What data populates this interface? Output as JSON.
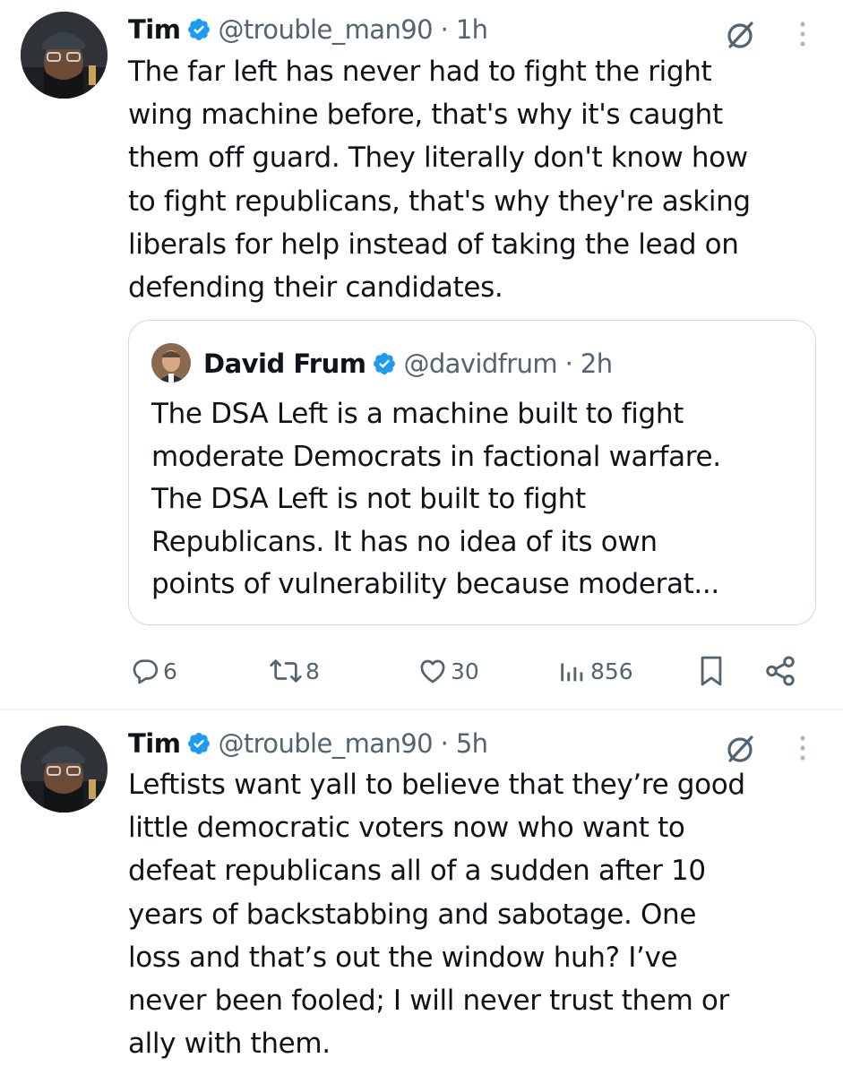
{
  "tweets": [
    {
      "author": {
        "name": "Tim",
        "handle": "@trouble_man90",
        "time": "1h"
      },
      "text": "The far left has never had to fight the right\nwing machine before, that's why it's caught\nthem off guard. They literally don't know how\nto fight republicans, that's why they're asking\nliberals for help instead of taking the lead on\ndefending their candidates.",
      "quoted": {
        "author": {
          "name": "David Frum",
          "handle": "@davidfrum",
          "time": "2h"
        },
        "text": "The DSA Left is a machine built to fight\nmoderate Democrats in factional warfare.\nThe DSA Left is not built to fight\nRepublicans. It has no idea of its own\npoints of vulnerability because moderat..."
      },
      "actions": {
        "replies": "6",
        "reposts": "8",
        "likes": "30",
        "views": "856"
      }
    },
    {
      "author": {
        "name": "Tim",
        "handle": "@trouble_man90",
        "time": "5h"
      },
      "text": "Leftists want yall to believe that they’re good\nlittle democratic voters now who want to\ndefeat republicans all of a sudden after 10\nyears of backstabbing and sabotage. One\nloss and that’s out the window huh? I’ve\nnever been fooled; I will never trust them or\nally with them."
    }
  ],
  "separator": " · ",
  "colors": {
    "text": "#0f1419",
    "secondary": "#536471",
    "verified": "#1d9bf0",
    "border": "#cfd9de"
  },
  "icons": [
    "verified-badge-icon",
    "grok-icon",
    "more-icon",
    "reply-icon",
    "repost-icon",
    "like-icon",
    "views-icon",
    "bookmark-icon",
    "share-icon"
  ]
}
